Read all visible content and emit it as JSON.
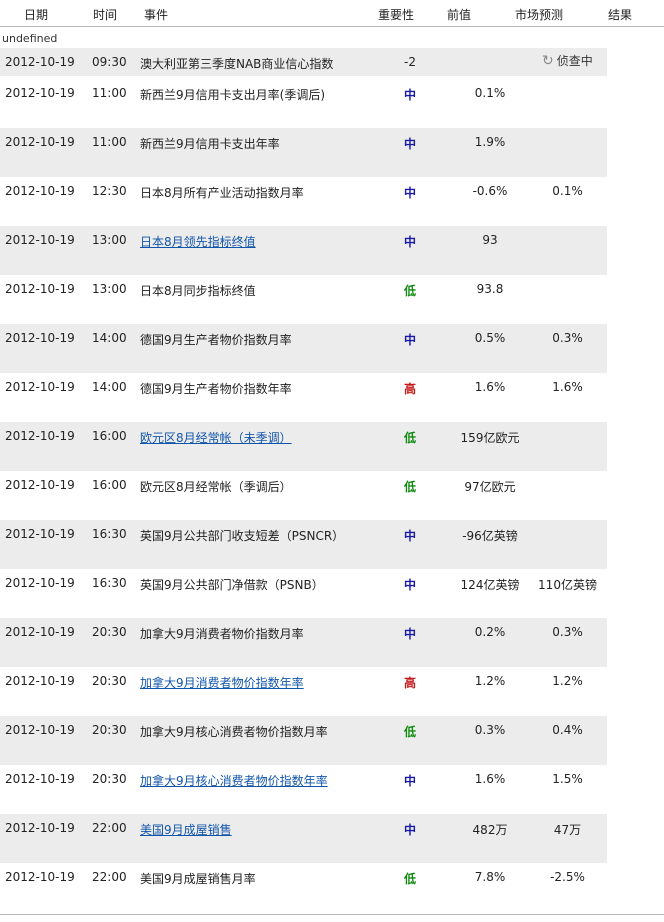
{
  "header": {
    "date": "日期",
    "time": "时间",
    "event": "事件",
    "importance": "重要性",
    "previous": "前值",
    "forecast": "市场预测",
    "result": "结果"
  },
  "group_label": "undefined",
  "status": {
    "icon": "refresh-icon",
    "text": "侦查中"
  },
  "colors": {
    "mid": "#1a1aa8",
    "low": "#128a12",
    "high": "#c41a1a",
    "link": "#1155aa",
    "row_alt": "#ececec"
  },
  "rows": [
    {
      "date": "2012-10-19",
      "time": "09:30",
      "event": "澳大利亚第三季度NAB商业信心指数",
      "link": false,
      "importance": "-2",
      "level": "num",
      "previous": "",
      "forecast": ""
    },
    {
      "date": "2012-10-19",
      "time": "11:00",
      "event": "新西兰9月信用卡支出月率(季调后)",
      "link": false,
      "importance": "中",
      "level": "mid",
      "previous": "0.1%",
      "forecast": ""
    },
    {
      "date": "2012-10-19",
      "time": "11:00",
      "event": "新西兰9月信用卡支出年率",
      "link": false,
      "importance": "中",
      "level": "mid",
      "previous": "1.9%",
      "forecast": ""
    },
    {
      "date": "2012-10-19",
      "time": "12:30",
      "event": "日本8月所有产业活动指数月率",
      "link": false,
      "importance": "中",
      "level": "mid",
      "previous": "-0.6%",
      "forecast": "0.1%"
    },
    {
      "date": "2012-10-19",
      "time": "13:00",
      "event": "日本8月领先指标终值",
      "link": true,
      "importance": "中",
      "level": "mid",
      "previous": "93",
      "forecast": ""
    },
    {
      "date": "2012-10-19",
      "time": "13:00",
      "event": "日本8月同步指标终值",
      "link": false,
      "importance": "低",
      "level": "low",
      "previous": "93.8",
      "forecast": ""
    },
    {
      "date": "2012-10-19",
      "time": "14:00",
      "event": "德国9月生产者物价指数月率",
      "link": false,
      "importance": "中",
      "level": "mid",
      "previous": "0.5%",
      "forecast": "0.3%"
    },
    {
      "date": "2012-10-19",
      "time": "14:00",
      "event": "德国9月生产者物价指数年率",
      "link": false,
      "importance": "高",
      "level": "high",
      "previous": "1.6%",
      "forecast": "1.6%"
    },
    {
      "date": "2012-10-19",
      "time": "16:00",
      "event": "欧元区8月经常帐（未季调）",
      "link": true,
      "importance": "低",
      "level": "low",
      "previous": "159亿欧元",
      "forecast": ""
    },
    {
      "date": "2012-10-19",
      "time": "16:00",
      "event": "欧元区8月经常帐（季调后）",
      "link": false,
      "importance": "低",
      "level": "low",
      "previous": "97亿欧元",
      "forecast": ""
    },
    {
      "date": "2012-10-19",
      "time": "16:30",
      "event": "英国9月公共部门收支短差（PSNCR）",
      "link": false,
      "importance": "中",
      "level": "mid",
      "previous": "-96亿英镑",
      "forecast": ""
    },
    {
      "date": "2012-10-19",
      "time": "16:30",
      "event": "英国9月公共部门净借款（PSNB）",
      "link": false,
      "importance": "中",
      "level": "mid",
      "previous": "124亿英镑",
      "forecast": "110亿英镑"
    },
    {
      "date": "2012-10-19",
      "time": "20:30",
      "event": "加拿大9月消费者物价指数月率",
      "link": false,
      "importance": "中",
      "level": "mid",
      "previous": "0.2%",
      "forecast": "0.3%"
    },
    {
      "date": "2012-10-19",
      "time": "20:30",
      "event": "加拿大9月消费者物价指数年率",
      "link": true,
      "importance": "高",
      "level": "high",
      "previous": "1.2%",
      "forecast": "1.2%"
    },
    {
      "date": "2012-10-19",
      "time": "20:30",
      "event": "加拿大9月核心消费者物价指数月率",
      "link": false,
      "importance": "低",
      "level": "low",
      "previous": "0.3%",
      "forecast": "0.4%"
    },
    {
      "date": "2012-10-19",
      "time": "20:30",
      "event": "加拿大9月核心消费者物价指数年率",
      "link": true,
      "importance": "中",
      "level": "mid",
      "previous": "1.6%",
      "forecast": "1.5%"
    },
    {
      "date": "2012-10-19",
      "time": "22:00",
      "event": "美国9月成屋销售",
      "link": true,
      "importance": "中",
      "level": "mid",
      "previous": "482万",
      "forecast": "47万"
    },
    {
      "date": "2012-10-19",
      "time": "22:00",
      "event": "美国9月成屋销售月率",
      "link": false,
      "importance": "低",
      "level": "low",
      "previous": "7.8%",
      "forecast": "-2.5%"
    }
  ]
}
